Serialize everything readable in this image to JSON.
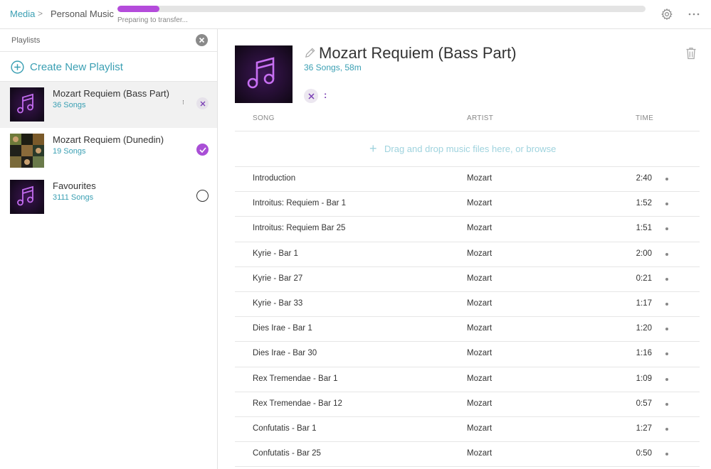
{
  "header": {
    "breadcrumb_root": "Media",
    "breadcrumb_sep": ">",
    "breadcrumb_current": "Personal Music",
    "progress_fraction": 0.08,
    "progress_text": "Preparing to transfer...",
    "settings_icon": "gear-icon",
    "more_icon": "ellipsis-icon"
  },
  "sidebar": {
    "title": "Playlists",
    "create_label": "Create New Playlist",
    "playlists": [
      {
        "name": "Mozart Requiem (Bass Part)",
        "count": "36 Songs",
        "state": "active"
      },
      {
        "name": "Mozart Requiem (Dunedin)",
        "count": "19 Songs",
        "state": "checked"
      },
      {
        "name": "Favourites",
        "count": "3111 Songs",
        "state": "unchecked"
      }
    ]
  },
  "main": {
    "title": "Mozart Requiem (Bass Part)",
    "meta": "36 Songs, 58m",
    "meta_colon": ":",
    "columns": {
      "song": "SONG",
      "artist": "ARTIST",
      "time": "TIME"
    },
    "drop_text": "Drag and drop music files here, or browse",
    "songs": [
      {
        "title": "Introduction",
        "artist": "Mozart",
        "time": "2:40"
      },
      {
        "title": "Introitus: Requiem - Bar 1",
        "artist": "Mozart",
        "time": "1:52"
      },
      {
        "title": "Introitus: Requiem Bar 25",
        "artist": "Mozart",
        "time": "1:51"
      },
      {
        "title": "Kyrie - Bar 1",
        "artist": "Mozart",
        "time": "2:00"
      },
      {
        "title": "Kyrie - Bar 27",
        "artist": "Mozart",
        "time": "0:21"
      },
      {
        "title": "Kyrie - Bar 33",
        "artist": "Mozart",
        "time": "1:17"
      },
      {
        "title": "Dies Irae - Bar 1",
        "artist": "Mozart",
        "time": "1:20"
      },
      {
        "title": "Dies Irae - Bar 30",
        "artist": "Mozart",
        "time": "1:16"
      },
      {
        "title": "Rex Tremendae - Bar 1",
        "artist": "Mozart",
        "time": "1:09"
      },
      {
        "title": "Rex Tremendae - Bar 12",
        "artist": "Mozart",
        "time": "0:57"
      },
      {
        "title": "Confutatis - Bar 1",
        "artist": "Mozart",
        "time": "1:27"
      },
      {
        "title": "Confutatis - Bar 25",
        "artist": "Mozart",
        "time": "0:50"
      }
    ]
  },
  "colors": {
    "accent_teal": "#3a9fb3",
    "accent_purple": "#a94fd6",
    "progress_purple": "#b44bdb"
  }
}
